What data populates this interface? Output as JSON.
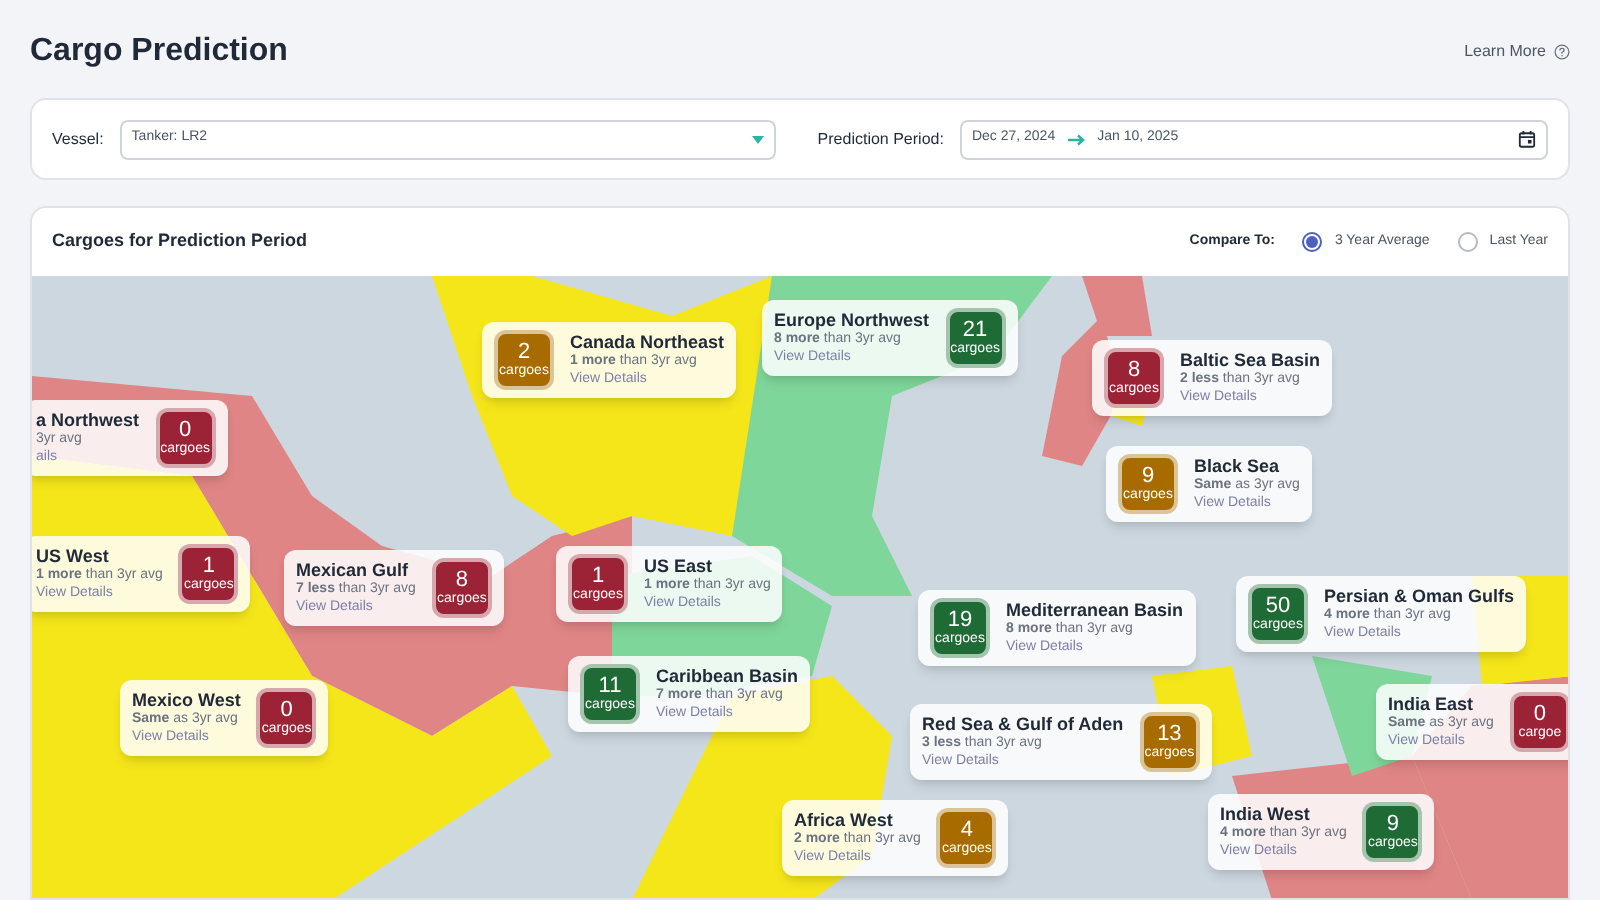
{
  "page": {
    "title": "Cargo Prediction",
    "help_link": "Learn More"
  },
  "filters": {
    "vessel_label": "Vessel:",
    "vessel_value": "Tanker: LR2",
    "period_label": "Prediction Period:",
    "period_start": "Dec 27, 2024",
    "period_end": "Jan 10, 2025"
  },
  "panel": {
    "title": "Cargoes for Prediction Period",
    "compare_label": "Compare To:",
    "compare_options": [
      {
        "label": "3 Year Average",
        "selected": true
      },
      {
        "label": "Last Year",
        "selected": false
      }
    ]
  },
  "regions": [
    {
      "name": "Canada Northeast",
      "delta": "**1 more** than 3yr avg",
      "link": "View Details",
      "count": "2",
      "unit": "cargoes",
      "color": "#a86b00"
    },
    {
      "name": "Europe Northwest",
      "delta": "**8 more** than 3yr avg",
      "link": "View Details",
      "count": "21",
      "unit": "cargoes",
      "color": "#1f6b36"
    },
    {
      "name": "a Northwest",
      "delta": "3yr avg",
      "link": "ails",
      "count": "0",
      "unit": "cargoes",
      "color": "#9b2335"
    },
    {
      "name": "Baltic Sea Basin",
      "delta": "**2 less** than 3yr avg",
      "link": "View Details",
      "count": "8",
      "unit": "cargoes",
      "color": "#9b2335"
    },
    {
      "name": "Black Sea",
      "delta": "**Same** as 3yr avg",
      "link": "View Details",
      "count": "9",
      "unit": "cargoes",
      "color": "#a86b00"
    },
    {
      "name": "US West",
      "delta": "**1 more** than 3yr avg",
      "link": "View Details",
      "count": "1",
      "unit": "cargoes",
      "color": "#9b2335"
    },
    {
      "name": "Mexican Gulf",
      "delta": "**7 less** than 3yr avg",
      "link": "View Details",
      "count": "8",
      "unit": "cargoes",
      "color": "#9b2335"
    },
    {
      "name": "US East",
      "delta": "**1 more** than 3yr avg",
      "link": "View Details",
      "count": "1",
      "unit": "cargoes",
      "color": "#9b2335"
    },
    {
      "name": "Mediterranean Basin",
      "delta": "**8 more** than 3yr avg",
      "link": "View Details",
      "count": "19",
      "unit": "cargoes",
      "color": "#1f6b36"
    },
    {
      "name": "Persian & Oman Gulfs",
      "delta": "**4 more** than 3yr avg",
      "link": "View Details",
      "count": "50",
      "unit": "cargoes",
      "color": "#1f6b36"
    },
    {
      "name": "Mexico West",
      "delta": "**Same** as 3yr avg",
      "link": "View Details",
      "count": "0",
      "unit": "cargoes",
      "color": "#9b2335"
    },
    {
      "name": "Caribbean Basin",
      "delta": "**7 more** than 3yr avg",
      "link": "View Details",
      "count": "11",
      "unit": "cargoes",
      "color": "#1f6b36"
    },
    {
      "name": "India East",
      "delta": "**Same** as 3yr avg",
      "link": "View Details",
      "count": "0",
      "unit": "cargoe",
      "color": "#9b2335"
    },
    {
      "name": "Red Sea & Gulf of Aden",
      "delta": "**3 less** than 3yr avg",
      "link": "View Details",
      "count": "13",
      "unit": "cargoes",
      "color": "#a86b00"
    },
    {
      "name": "Africa West",
      "delta": "**2 more** than 3yr avg",
      "link": "View Details",
      "count": "4",
      "unit": "cargoes",
      "color": "#a86b00"
    },
    {
      "name": "India West",
      "delta": "**4 more** than 3yr avg",
      "link": "View Details",
      "count": "9",
      "unit": "cargoes",
      "color": "#1f6b36"
    }
  ]
}
